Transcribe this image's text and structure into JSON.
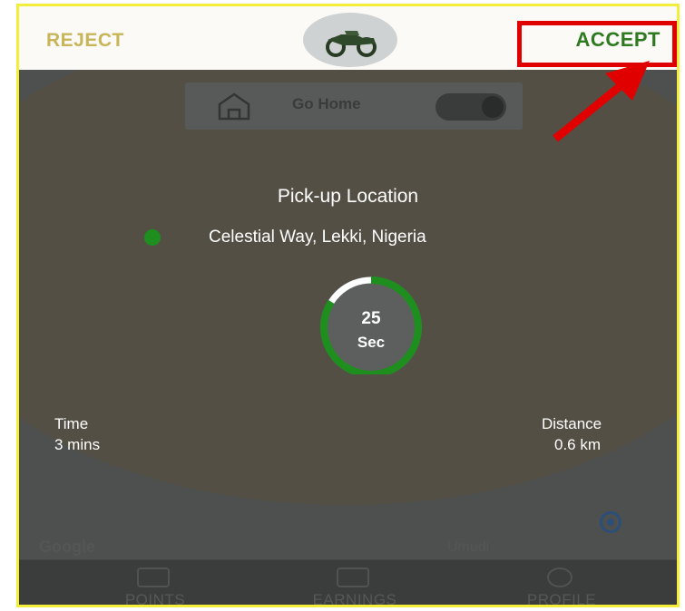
{
  "header": {
    "reject_label": "REJECT",
    "accept_label": "ACCEPT",
    "logo_icon": "motorbike-icon"
  },
  "map": {
    "go_home_label": "Go Home",
    "google_label": "Google",
    "place_label": "Umudi"
  },
  "trip": {
    "pickup_title": "Pick-up Location",
    "address": "Celestial Way, Lekki, Nigeria",
    "timer_value": "25",
    "timer_unit": "Sec",
    "timer_progress": 0.84,
    "time_label": "Time",
    "time_value": "3 mins",
    "distance_label": "Distance",
    "distance_value": "0.6 km"
  },
  "nav": {
    "items": [
      {
        "label": "POINTS",
        "icon": "points-icon"
      },
      {
        "label": "EARNINGS",
        "icon": "wallet-icon"
      },
      {
        "label": "PROFILE",
        "icon": "profile-icon"
      }
    ]
  },
  "colors": {
    "accept": "#2e7a20",
    "reject": "#c8b55a",
    "highlight": "#e00000",
    "frame": "#f3ee3a",
    "timer_ring": "#1e8f1e"
  }
}
